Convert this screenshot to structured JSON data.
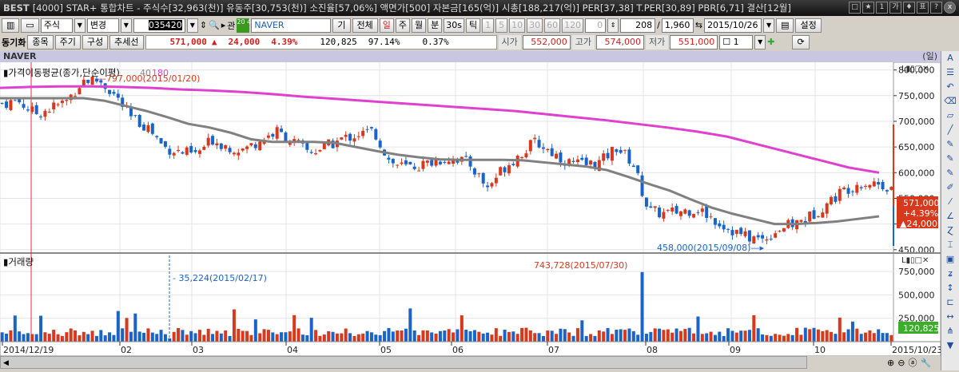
{
  "title": {
    "logo": "BEST",
    "text": "[4000] STAR+ 통합차트 - 주식수[32,963(천)] 유동주[30,753(천)] 소진율[57,06%] 액면가[500] 자본금[165(억)] 시총[188,217(억)] PER[37,38] T.PER[30,89] PBR[6,71] 결산[12월]",
    "buttons": [
      "□",
      "★",
      "1",
      "가",
      "♦",
      "표",
      "?",
      "x"
    ]
  },
  "toolbar": {
    "market": "주식",
    "change": "변경",
    "code": "035420",
    "gwan": "관",
    "time_badge": "20 45",
    "name": "NAVER",
    "gi": "기",
    "all": "전체",
    "periods": [
      "일",
      "주",
      "월",
      "분",
      "30s",
      "틱"
    ],
    "active_period": "일",
    "intervals": [
      "1",
      "5",
      "10",
      "30",
      "60",
      "120"
    ],
    "count_zero": "0",
    "count": "208",
    "total": "1,960",
    "date": "2015/10/26",
    "settings": "설정"
  },
  "quote": {
    "sync": "동기화",
    "buttons": [
      "종목",
      "주기",
      "구성",
      "추세선"
    ],
    "price": "571,000",
    "arrow": "▲",
    "change": "24,000",
    "pct": "4.39%",
    "volume": "120,825",
    "v1": "97.14%",
    "v2": "0.37%",
    "open_label": "시가",
    "open": "552,000",
    "high_label": "고가",
    "high": "574,000",
    "low_label": "저가",
    "low": "551,000",
    "layout_num": "1"
  },
  "chart_header": {
    "name": "NAVER",
    "unit": "(일)"
  },
  "chart_data": {
    "type": "candlestick",
    "price_title": "가격이동평균(종가,단순이평)",
    "ma_labels": [
      "40",
      "180"
    ],
    "volume_title": "거래량",
    "price_axis": {
      "ticks": [
        "800,000",
        "750,000",
        "700,000",
        "650,000",
        "600,000",
        "550,000",
        "500,000",
        "450,000"
      ],
      "range": [
        445000,
        815000
      ]
    },
    "volume_axis": {
      "ticks": [
        "750,000",
        "500,000",
        "250,000"
      ],
      "range": [
        0,
        870000
      ]
    },
    "x_labels": [
      "2014/12/19",
      "02",
      "03",
      "04",
      "05",
      "06",
      "07",
      "08",
      "09",
      "10",
      "2015/10/23"
    ],
    "close_path": [
      735,
      740,
      715,
      725,
      740,
      780,
      780,
      750,
      705,
      690,
      650,
      640,
      635,
      665,
      650,
      645,
      665,
      680,
      660,
      640,
      650,
      665,
      675,
      680,
      620,
      610,
      615,
      625,
      630,
      615,
      570,
      610,
      635,
      660,
      640,
      620,
      615,
      620,
      650,
      620,
      525,
      520,
      525,
      530,
      510,
      490,
      475,
      470,
      490,
      500,
      515,
      540,
      565,
      580,
      580,
      571
    ],
    "ma40": [
      745,
      745,
      745,
      745,
      745,
      740,
      730,
      720,
      708,
      695,
      688,
      678,
      665,
      660,
      660,
      660,
      658,
      650,
      642,
      635,
      630,
      626,
      625,
      625,
      625,
      624,
      620,
      616,
      612,
      605,
      592,
      578,
      565,
      548,
      532,
      520,
      510,
      500,
      500,
      502,
      505,
      510,
      515
    ],
    "ma180": [
      765,
      767,
      768,
      768,
      767,
      765,
      762,
      760,
      757,
      753,
      748,
      744,
      740,
      736,
      732,
      728,
      724,
      720,
      714,
      708,
      702,
      695,
      688,
      680,
      670,
      655,
      640,
      625,
      610,
      600
    ],
    "annotations": {
      "high": "797,000(2015/01/20)",
      "low": "458,000(2015/09/08)",
      "vol_low": "35,224(2015/02/17)",
      "vol_high": "743,728(2015/07/30)"
    },
    "last_price": {
      "price": "571,000",
      "pct": "+4.39%",
      "change": "▲24,000"
    },
    "last_volume": "120,825",
    "colors": {
      "up": "#d8381c",
      "down": "#1a64c8",
      "ma40": "#808080",
      "ma180": "#e040d0"
    }
  },
  "right_toolbar": {
    "top": "A"
  }
}
